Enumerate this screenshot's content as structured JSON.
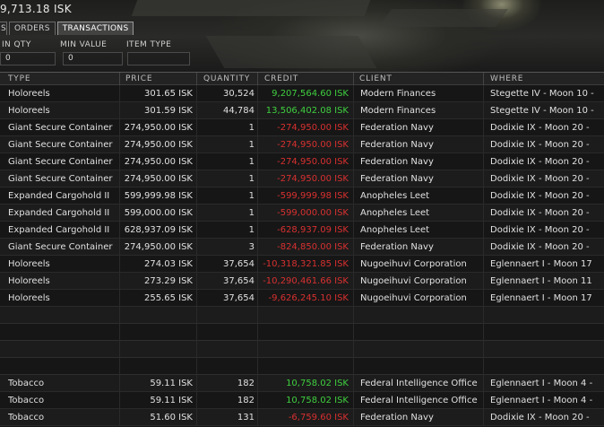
{
  "wallet": {
    "balance": "9,713.18 ISK"
  },
  "tabs": [
    {
      "label": "S"
    },
    {
      "label": "ORDERS"
    },
    {
      "label": "TRANSACTIONS",
      "active": true
    }
  ],
  "filters": {
    "min_qty_label": "IN QTY",
    "min_qty_value": "0",
    "min_value_label": "MIN VALUE",
    "min_value_value": "0",
    "item_type_label": "ITEM TYPE",
    "item_type_value": ""
  },
  "table": {
    "columns": [
      "TYPE",
      "PRICE",
      "QUANTITY",
      "CREDIT",
      "CLIENT",
      "WHERE"
    ],
    "rows": [
      {
        "type": "Holoreels",
        "price": "301.65 ISK",
        "qty": "30,524",
        "credit": "9,207,564.60 ISK",
        "sign": "pos",
        "client": "Modern Finances",
        "where": "Stegette IV - Moon 10 -"
      },
      {
        "type": "Holoreels",
        "price": "301.59 ISK",
        "qty": "44,784",
        "credit": "13,506,402.08 ISK",
        "sign": "pos",
        "client": "Modern Finances",
        "where": "Stegette IV - Moon 10 -"
      },
      {
        "type": "Giant Secure Container",
        "price": "274,950.00 ISK",
        "qty": "1",
        "credit": "-274,950.00 ISK",
        "sign": "neg",
        "client": "Federation Navy",
        "where": "Dodixie IX - Moon 20 -"
      },
      {
        "type": "Giant Secure Container",
        "price": "274,950.00 ISK",
        "qty": "1",
        "credit": "-274,950.00 ISK",
        "sign": "neg",
        "client": "Federation Navy",
        "where": "Dodixie IX - Moon 20 -"
      },
      {
        "type": "Giant Secure Container",
        "price": "274,950.00 ISK",
        "qty": "1",
        "credit": "-274,950.00 ISK",
        "sign": "neg",
        "client": "Federation Navy",
        "where": "Dodixie IX - Moon 20 -"
      },
      {
        "type": "Giant Secure Container",
        "price": "274,950.00 ISK",
        "qty": "1",
        "credit": "-274,950.00 ISK",
        "sign": "neg",
        "client": "Federation Navy",
        "where": "Dodixie IX - Moon 20 -"
      },
      {
        "type": "Expanded Cargohold II",
        "price": "599,999.98 ISK",
        "qty": "1",
        "credit": "-599,999.98 ISK",
        "sign": "neg",
        "client": "Anopheles Leet",
        "where": "Dodixie IX - Moon 20 -"
      },
      {
        "type": "Expanded Cargohold II",
        "price": "599,000.00 ISK",
        "qty": "1",
        "credit": "-599,000.00 ISK",
        "sign": "neg",
        "client": "Anopheles Leet",
        "where": "Dodixie IX - Moon 20 -"
      },
      {
        "type": "Expanded Cargohold II",
        "price": "628,937.09 ISK",
        "qty": "1",
        "credit": "-628,937.09 ISK",
        "sign": "neg",
        "client": "Anopheles Leet",
        "where": "Dodixie IX - Moon 20 -"
      },
      {
        "type": "Giant Secure Container",
        "price": "274,950.00 ISK",
        "qty": "3",
        "credit": "-824,850.00 ISK",
        "sign": "neg",
        "client": "Federation Navy",
        "where": "Dodixie IX - Moon 20 -"
      },
      {
        "type": "Holoreels",
        "price": "274.03 ISK",
        "qty": "37,654",
        "credit": "-10,318,321.85 ISK",
        "sign": "neg",
        "client": "Nugoeihuvi Corporation",
        "where": "Eglennaert I - Moon 17"
      },
      {
        "type": "Holoreels",
        "price": "273.29 ISK",
        "qty": "37,654",
        "credit": "-10,290,461.66 ISK",
        "sign": "neg",
        "client": "Nugoeihuvi Corporation",
        "where": "Eglennaert I - Moon 11"
      },
      {
        "type": "Holoreels",
        "price": "255.65 ISK",
        "qty": "37,654",
        "credit": "-9,626,245.10 ISK",
        "sign": "neg",
        "client": "Nugoeihuvi Corporation",
        "where": "Eglennaert I - Moon 17"
      },
      {
        "blank": true
      },
      {
        "blank": true
      },
      {
        "blank": true
      },
      {
        "blank": true
      },
      {
        "type": "Tobacco",
        "price": "59.11 ISK",
        "qty": "182",
        "credit": "10,758.02 ISK",
        "sign": "pos",
        "client": "Federal Intelligence Office",
        "where": "Eglennaert I - Moon 4 -"
      },
      {
        "type": "Tobacco",
        "price": "59.11 ISK",
        "qty": "182",
        "credit": "10,758.02 ISK",
        "sign": "pos",
        "client": "Federal Intelligence Office",
        "where": "Eglennaert I - Moon 4 -"
      },
      {
        "type": "Tobacco",
        "price": "51.60 ISK",
        "qty": "131",
        "credit": "-6,759.60 ISK",
        "sign": "neg",
        "client": "Federation Navy",
        "where": "Dodixie IX - Moon 20 -"
      }
    ]
  },
  "colors": {
    "positive": "#3fcf3f",
    "negative": "#d83030"
  }
}
